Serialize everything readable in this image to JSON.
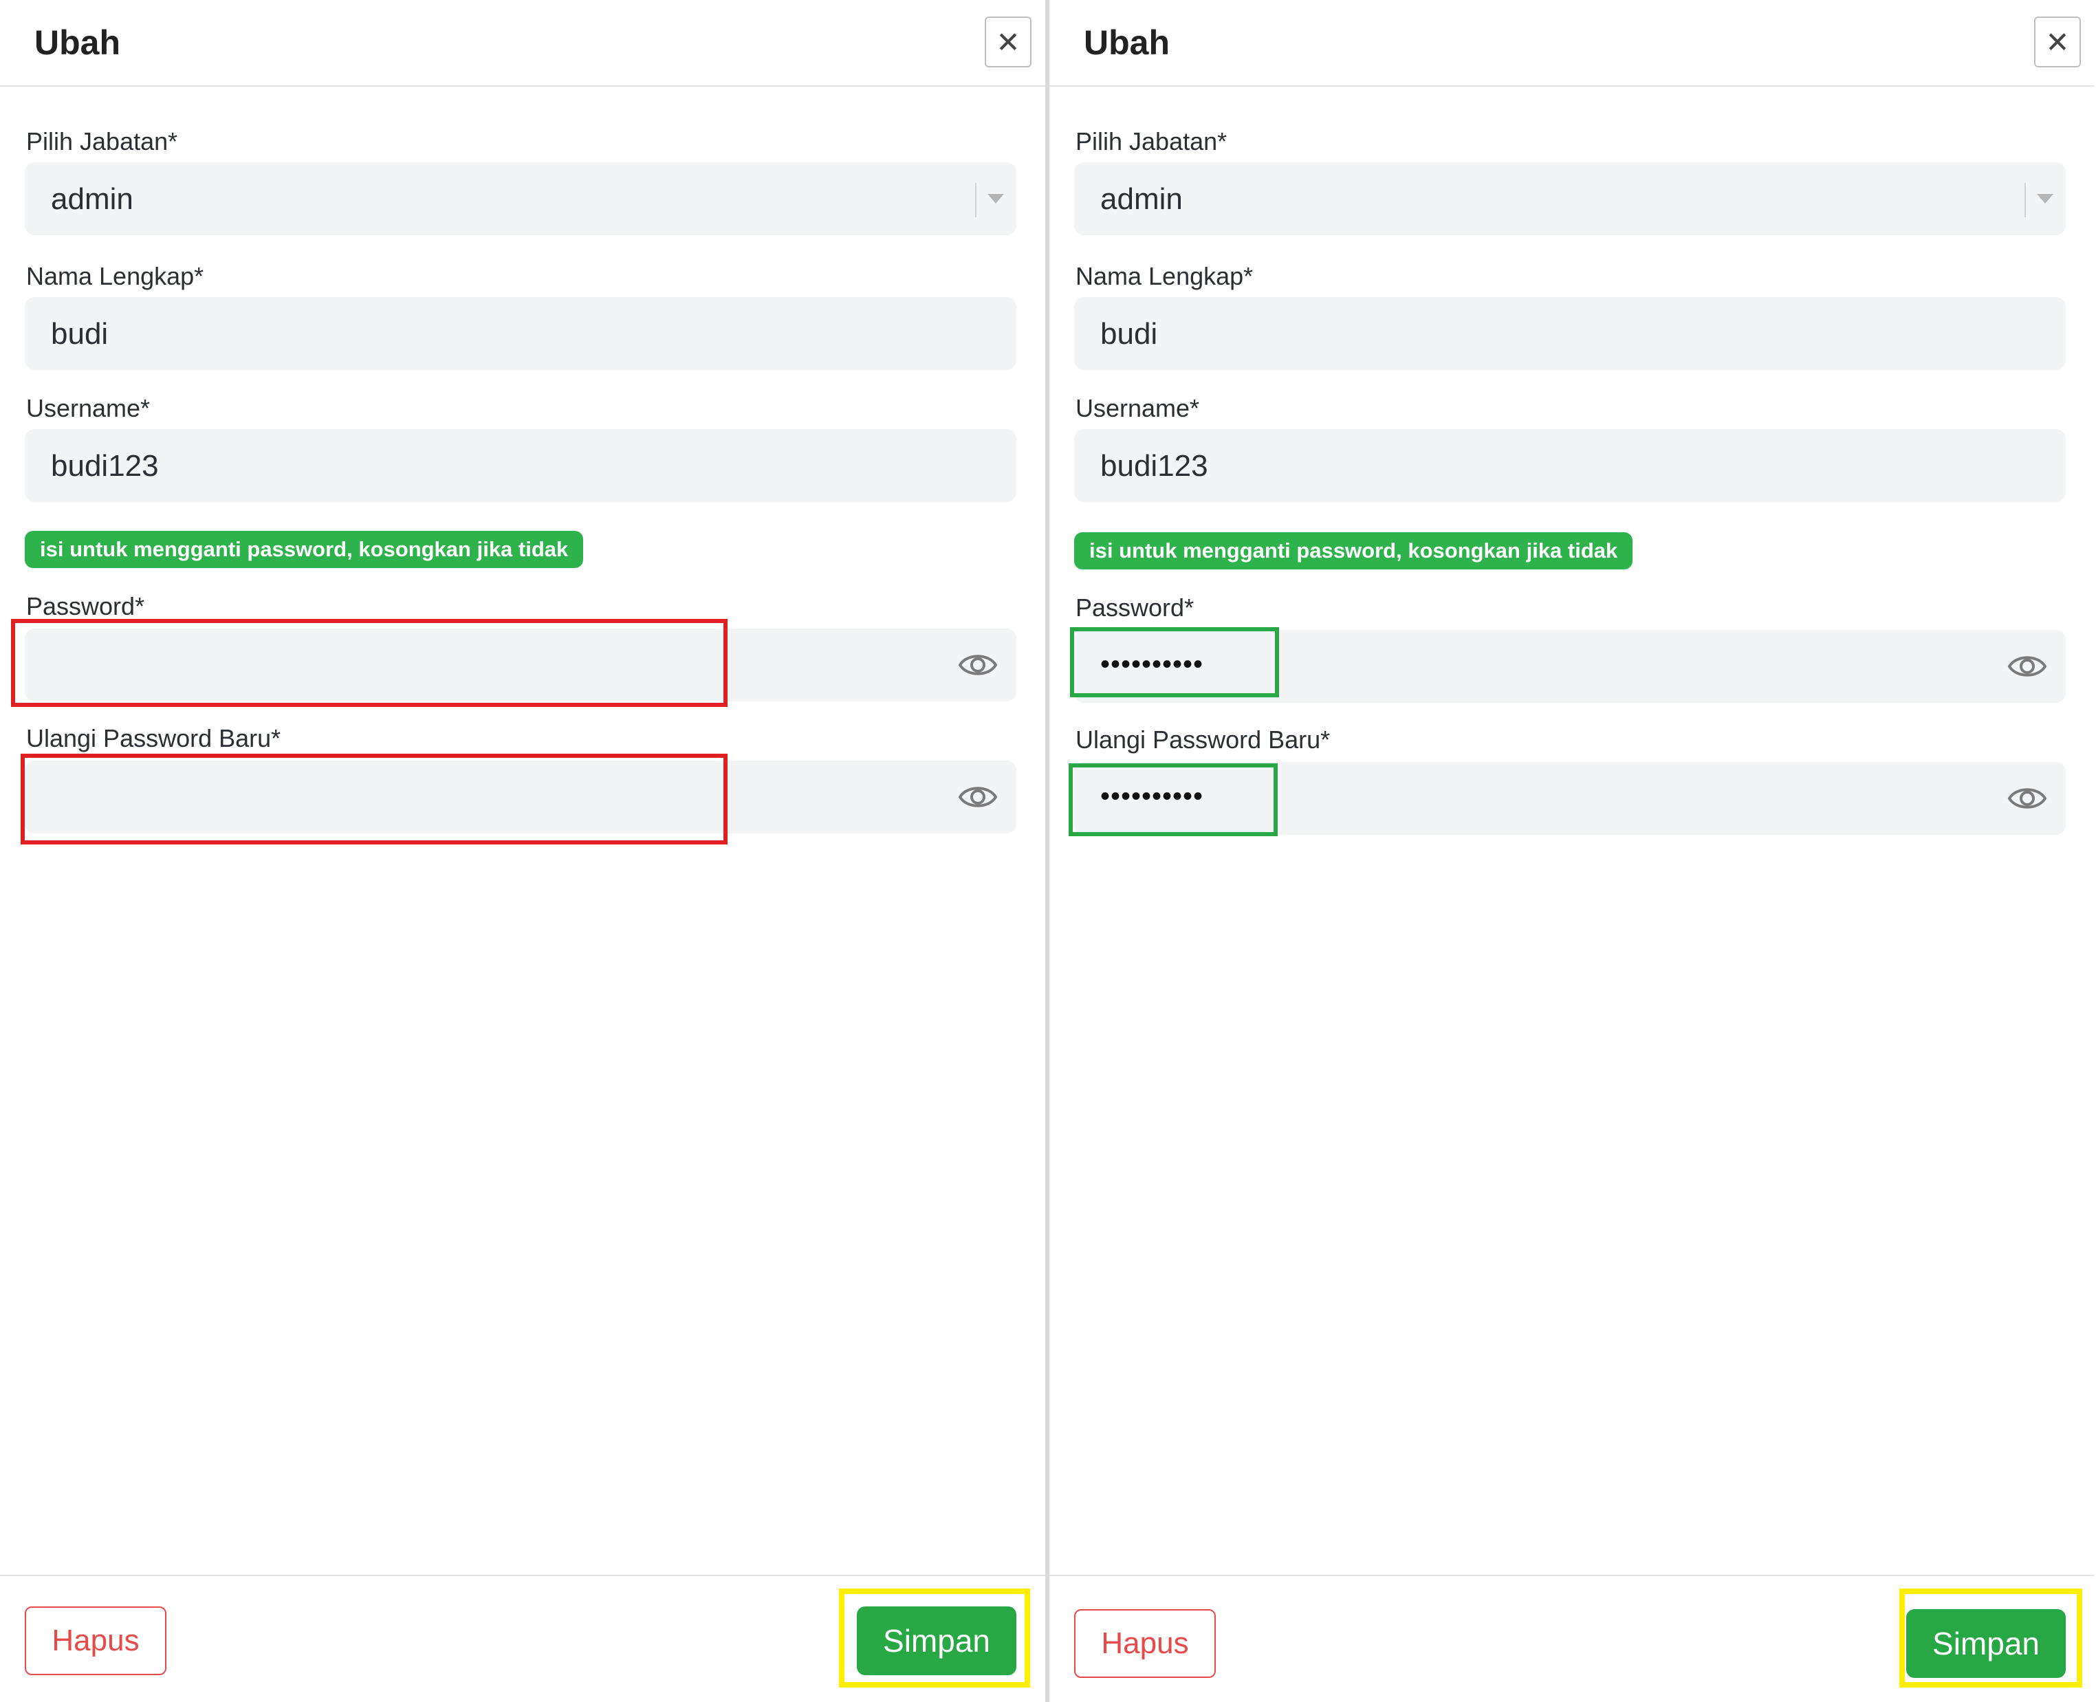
{
  "panels": [
    {
      "title": "Ubah",
      "close_icon": "close-icon",
      "fields": {
        "jabatan_label": "Pilih Jabatan*",
        "jabatan_value": "admin",
        "nama_label": "Nama Lengkap*",
        "nama_value": "budi",
        "username_label": "Username*",
        "username_value": "budi123",
        "hint": "isi untuk mengganti password, kosongkan jika tidak",
        "password_label": "Password*",
        "password_value": "",
        "ulangi_label": "Ulangi Password Baru*",
        "ulangi_value": ""
      },
      "footer": {
        "delete_label": "Hapus",
        "save_label": "Simpan"
      },
      "highlight": "red"
    },
    {
      "title": "Ubah",
      "close_icon": "close-icon",
      "fields": {
        "jabatan_label": "Pilih Jabatan*",
        "jabatan_value": "admin",
        "nama_label": "Nama Lengkap*",
        "nama_value": "budi",
        "username_label": "Username*",
        "username_value": "budi123",
        "hint": "isi untuk mengganti password, kosongkan jika tidak",
        "password_label": "Password*",
        "password_value": "••••••••••",
        "ulangi_label": "Ulangi Password Baru*",
        "ulangi_value": "••••••••••"
      },
      "footer": {
        "delete_label": "Hapus",
        "save_label": "Simpan"
      },
      "highlight": "green"
    }
  ],
  "colors": {
    "accent_green": "#28a745",
    "hint_green": "#2eb24b",
    "delete_red": "#e84a4a",
    "highlight_red": "#e02020",
    "highlight_green": "#28a745",
    "highlight_yellow": "#ffee00"
  }
}
